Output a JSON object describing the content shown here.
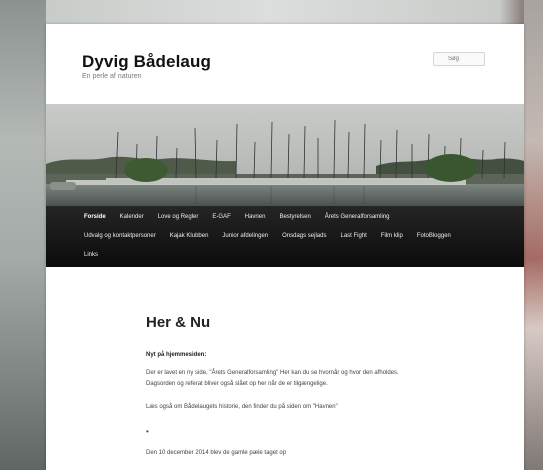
{
  "site": {
    "title": "Dyvig Bådelaug",
    "description": "En perle af naturen"
  },
  "search": {
    "placeholder": "Søg"
  },
  "nav": {
    "row1": [
      {
        "label": "Forside",
        "current": true
      },
      {
        "label": "Kalender"
      },
      {
        "label": "Love og Regler"
      },
      {
        "label": "E-GAF"
      },
      {
        "label": "Havnen"
      },
      {
        "label": "Bestyrelsen"
      },
      {
        "label": "Årets Generalforsamling"
      }
    ],
    "row2": [
      {
        "label": "Udvalg og kontaktpersoner"
      },
      {
        "label": "Kajak Klubben"
      },
      {
        "label": "Junior afdelingen"
      },
      {
        "label": "Onsdags sejlads"
      },
      {
        "label": "Last Fight"
      },
      {
        "label": "Film klip"
      },
      {
        "label": "FotoBloggen"
      }
    ],
    "row3": [
      {
        "label": "Links"
      }
    ]
  },
  "article": {
    "title": "Her & Nu",
    "subheading": "Nyt på hjemmesiden:",
    "p1": "Der er lavet en ny side, \"Årets Generalforsamling\" Her kan du se hvornår og hvor den afholdes. Dagsorden og referat bliver også slået op her når de er tilgængelige.",
    "p2": "Læs også om Bådelaugets historie, den finder du på siden om \"Havnen\"",
    "bullet": "•",
    "p3": "Den 10 december 2014 blev de gamle pæle taget op"
  }
}
